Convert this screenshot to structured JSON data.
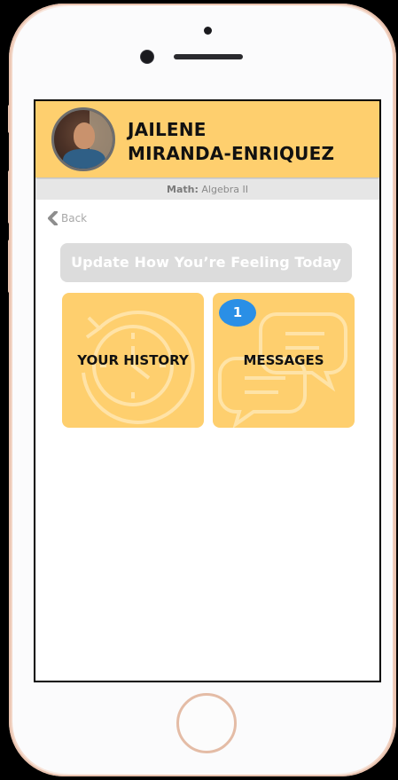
{
  "profile": {
    "first_name": "JAILENE",
    "last_name": "MIRANDA-ENRIQUEZ",
    "avatar_icon": "avatar-photo"
  },
  "subject": {
    "label": "Math:",
    "value": "Algebra II"
  },
  "nav": {
    "back_label": "Back"
  },
  "actions": {
    "feeling_label": "Update How You’re Feeling Today"
  },
  "tiles": {
    "history": {
      "label": "YOUR HISTORY",
      "icon": "history-clock-icon"
    },
    "messages": {
      "label": "MESSAGES",
      "icon": "chat-bubbles-icon",
      "badge_count": "1"
    }
  },
  "colors": {
    "accent": "#fecf6e",
    "badge": "#2a8fe6",
    "button_disabled": "#dcdcdc",
    "subject_bar": "#e6e6e6"
  }
}
